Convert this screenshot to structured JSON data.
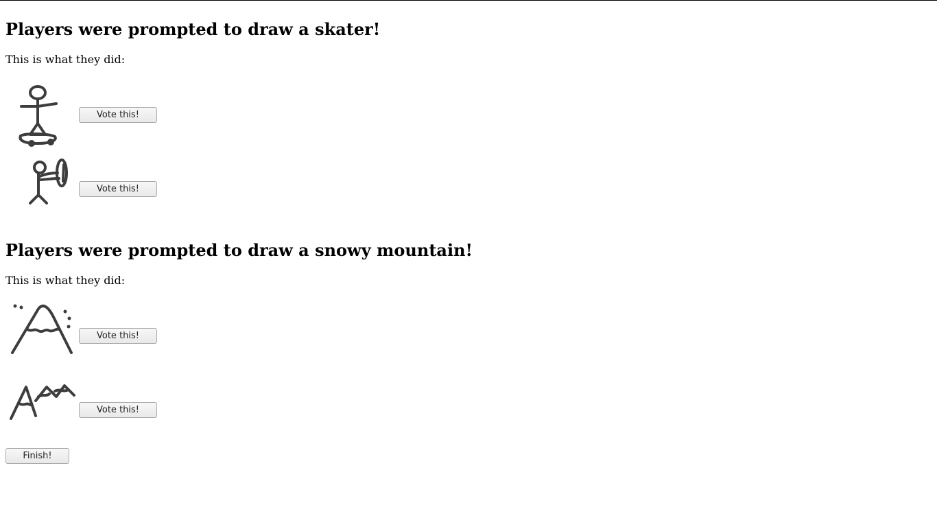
{
  "sections": [
    {
      "heading": "Players were prompted to draw a skater!",
      "subtitle": "This is what they did:",
      "entries": [
        {
          "drawing_icon": "skater-on-skateboard-drawing",
          "vote_label": "Vote this!"
        },
        {
          "drawing_icon": "stick-figure-with-shield-drawing",
          "vote_label": "Vote this!"
        }
      ]
    },
    {
      "heading": "Players were prompted to draw a snowy mountain!",
      "subtitle": "This is what they did:",
      "entries": [
        {
          "drawing_icon": "single-snowy-mountain-drawing",
          "vote_label": "Vote this!"
        },
        {
          "drawing_icon": "mountain-range-drawing",
          "vote_label": "Vote this!"
        }
      ]
    }
  ],
  "finish_label": "Finish!"
}
